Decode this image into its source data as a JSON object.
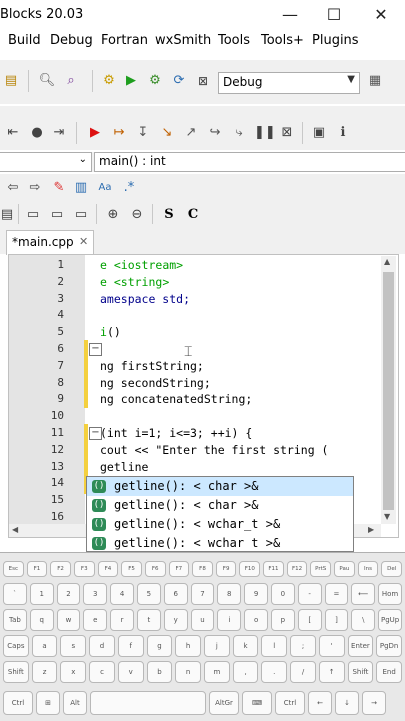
{
  "window": {
    "title": "Blocks 20.03",
    "min": "—",
    "max": "☐",
    "close": "✕"
  },
  "menu": [
    "Build",
    "Debug",
    "Fortran",
    "wxSmith",
    "Tools",
    "Tools+",
    "Plugins"
  ],
  "build_target": {
    "value": "Debug"
  },
  "scope": {
    "function": "main() : int"
  },
  "editor": {
    "tab_label": "*main.cpp",
    "tab_close": "✕",
    "lines": [
      {
        "n": "1",
        "code": "<iostream>",
        "prefix": "e ",
        "class": "pp"
      },
      {
        "n": "2",
        "code": "<string>",
        "prefix": "e ",
        "class": "pp"
      },
      {
        "n": "3",
        "code": "amespace std;",
        "prefix": "",
        "class": "kw"
      },
      {
        "n": "4",
        "code": "",
        "prefix": "",
        "class": ""
      },
      {
        "n": "5",
        "code": "()",
        "prefix": "i",
        "class": ""
      },
      {
        "n": "6",
        "code": "",
        "prefix": "",
        "class": ""
      },
      {
        "n": "7",
        "code": "ng firstString;",
        "prefix": "",
        "class": ""
      },
      {
        "n": "8",
        "code": "ng secondString;",
        "prefix": "",
        "class": ""
      },
      {
        "n": "9",
        "code": "ng concatenatedString;",
        "prefix": "",
        "class": ""
      },
      {
        "n": "10",
        "code": "",
        "prefix": "",
        "class": ""
      },
      {
        "n": "11",
        "code": "(int i=1; i<=3; ++i) {",
        "prefix": "",
        "class": ""
      },
      {
        "n": "12",
        "code": "cout << \"Enter the first string (",
        "prefix": "",
        "class": ""
      },
      {
        "n": "13",
        "code": "getline",
        "prefix": "",
        "class": ""
      },
      {
        "n": "14",
        "code": "",
        "prefix": "",
        "class": ""
      },
      {
        "n": "15",
        "code": "",
        "prefix": "",
        "class": ""
      },
      {
        "n": "16",
        "code": "",
        "prefix": "",
        "class": ""
      }
    ]
  },
  "autocomplete": [
    {
      "icon": "()",
      "text": "getline(): < char >&"
    },
    {
      "icon": "()",
      "text": "getline(): < char >&"
    },
    {
      "icon": "()",
      "text": "getline(): < wchar_t >&"
    },
    {
      "icon": "()",
      "text": "getline(): < wchar t >&"
    }
  ],
  "keyboard": {
    "row0": [
      "Esc",
      "F1",
      "F2",
      "F3",
      "F4",
      "F5",
      "F6",
      "F7",
      "F8",
      "F9",
      "F10",
      "F11",
      "F12",
      "PrtS",
      "Pau",
      "Ins",
      "Del"
    ],
    "row1": [
      "`",
      "1",
      "2",
      "3",
      "4",
      "5",
      "6",
      "7",
      "8",
      "9",
      "0",
      "-",
      "=",
      "⟵",
      "Hom"
    ],
    "row2": [
      "Tab",
      "q",
      "w",
      "e",
      "r",
      "t",
      "y",
      "u",
      "i",
      "o",
      "p",
      "[",
      "]",
      "\\",
      "PgUp"
    ],
    "row3": [
      "Caps",
      "a",
      "s",
      "d",
      "f",
      "g",
      "h",
      "j",
      "k",
      "l",
      ";",
      "'",
      "Enter",
      "PgDn"
    ],
    "row4": [
      "Shift",
      "z",
      "x",
      "c",
      "v",
      "b",
      "n",
      "m",
      ",",
      ".",
      "/",
      "↑",
      "Shift",
      "End"
    ],
    "row5": [
      "Ctrl",
      "⊞",
      "Alt",
      "",
      "AltGr",
      "⌨",
      "Ctrl",
      "←",
      "↓",
      "→"
    ]
  }
}
